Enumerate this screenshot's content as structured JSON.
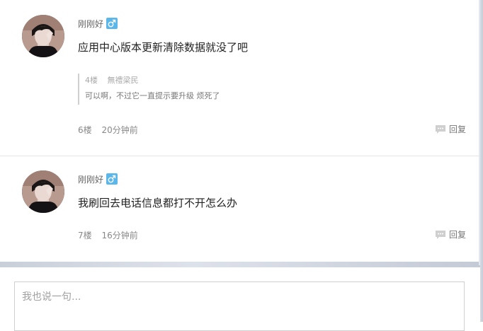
{
  "posts": [
    {
      "username": "刚刚好",
      "gender": "male",
      "content": "应用中心版本更新清除数据就没了吧",
      "quote": {
        "floor": "4楼",
        "author": "無禮梁民",
        "text": "可以啊，不过它一直提示要升级  烦死了"
      },
      "floor": "6楼",
      "time": "20分钟前",
      "reply_label": "回复"
    },
    {
      "username": "刚刚好",
      "gender": "male",
      "content": "我刷回去电话信息都打不开怎么办",
      "floor": "7楼",
      "time": "16分钟前",
      "reply_label": "回复"
    }
  ],
  "composer": {
    "placeholder": "我也说一句..."
  },
  "colors": {
    "gender_badge": "#5bb7ea",
    "text_primary": "#222222",
    "text_meta": "#888888"
  },
  "icons": [
    "avatar",
    "male-gender-icon",
    "reply-bubble-icon"
  ]
}
